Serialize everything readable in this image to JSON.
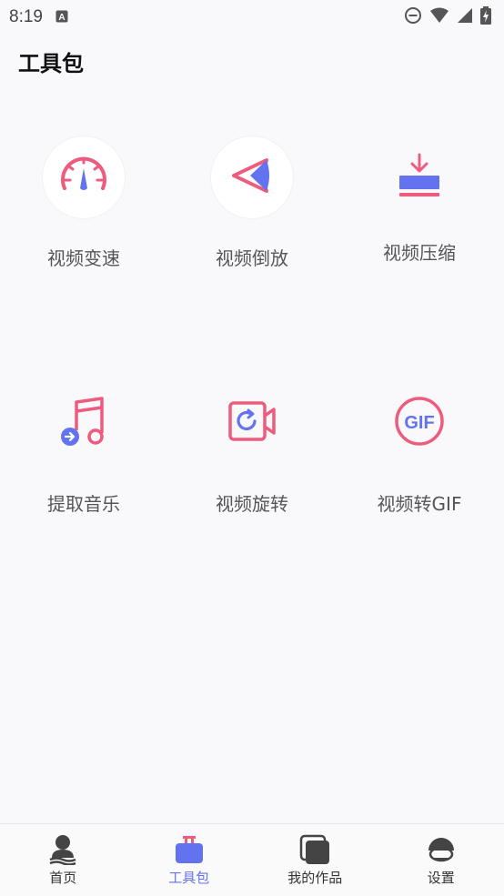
{
  "status_bar": {
    "time": "8:19"
  },
  "header": {
    "title": "工具包"
  },
  "tools": [
    {
      "label": "视频变速",
      "icon": "speedometer-icon"
    },
    {
      "label": "视频倒放",
      "icon": "reverse-play-icon"
    },
    {
      "label": "视频压缩",
      "icon": "download-compress-icon"
    },
    {
      "label": "提取音乐",
      "icon": "music-note-icon"
    },
    {
      "label": "视频旋转",
      "icon": "video-rotate-icon"
    },
    {
      "label": "视频转GIF",
      "icon": "gif-icon"
    }
  ],
  "bottom_nav": {
    "items": [
      {
        "label": "首页",
        "icon": "person-icon",
        "active": false
      },
      {
        "label": "工具包",
        "icon": "toolbox-icon",
        "active": true
      },
      {
        "label": "我的作品",
        "icon": "works-icon",
        "active": false
      },
      {
        "label": "设置",
        "icon": "settings-avatar-icon",
        "active": false
      }
    ]
  },
  "colors": {
    "accent_blue": "#6373f0",
    "accent_pink": "#ef5b7c",
    "background": "#f9f9fc"
  }
}
